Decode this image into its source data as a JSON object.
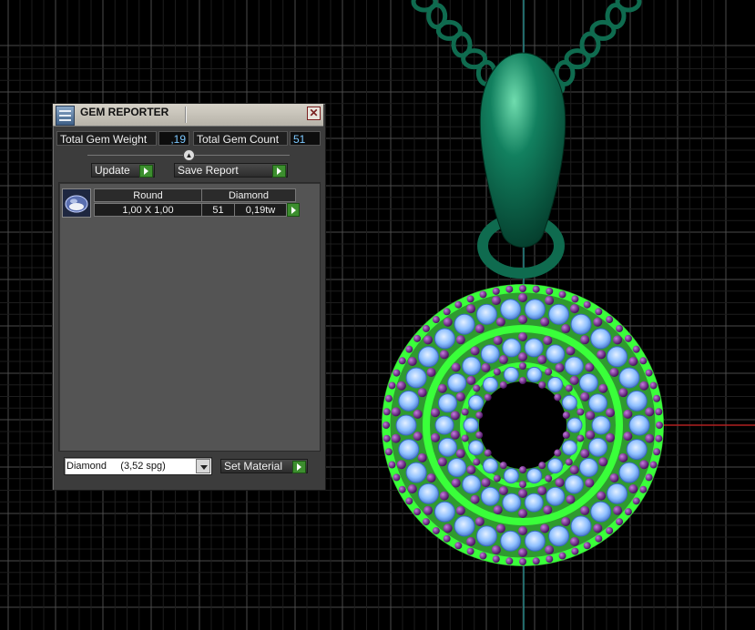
{
  "window": {
    "title": "GEM REPORTER",
    "close_glyph": "✕"
  },
  "summary": {
    "total_weight_label": "Total Gem Weight",
    "total_weight_value": ",19",
    "total_count_label": "Total Gem Count",
    "total_count_value": "51"
  },
  "toolbar": {
    "update_label": "Update",
    "save_report_label": "Save Report"
  },
  "gem_list": {
    "headers": [
      "Round",
      "Diamond"
    ],
    "rows": [
      {
        "size": "1,00 X 1,00",
        "count": "51",
        "weight": "0,19tw"
      }
    ]
  },
  "material": {
    "selected": "Diamond     (3,52 spg)",
    "set_label": "Set Material"
  },
  "icons": {
    "app": "gem-reporter-app-icon",
    "close": "close-icon",
    "collapse": "collapse-icon",
    "thumb": "round-gem-icon",
    "go": "play-arrow-icon",
    "dropdown": "chevron-down-icon"
  },
  "colors": {
    "background": "#000000",
    "chain": "#0f6b4f",
    "bail": "#12805f",
    "ring": "#3aff3a",
    "gem": "#7ab6ff",
    "prong": "#6b1b8a",
    "value_text": "#7cc8ff",
    "accent_green": "#3c8e2e"
  }
}
